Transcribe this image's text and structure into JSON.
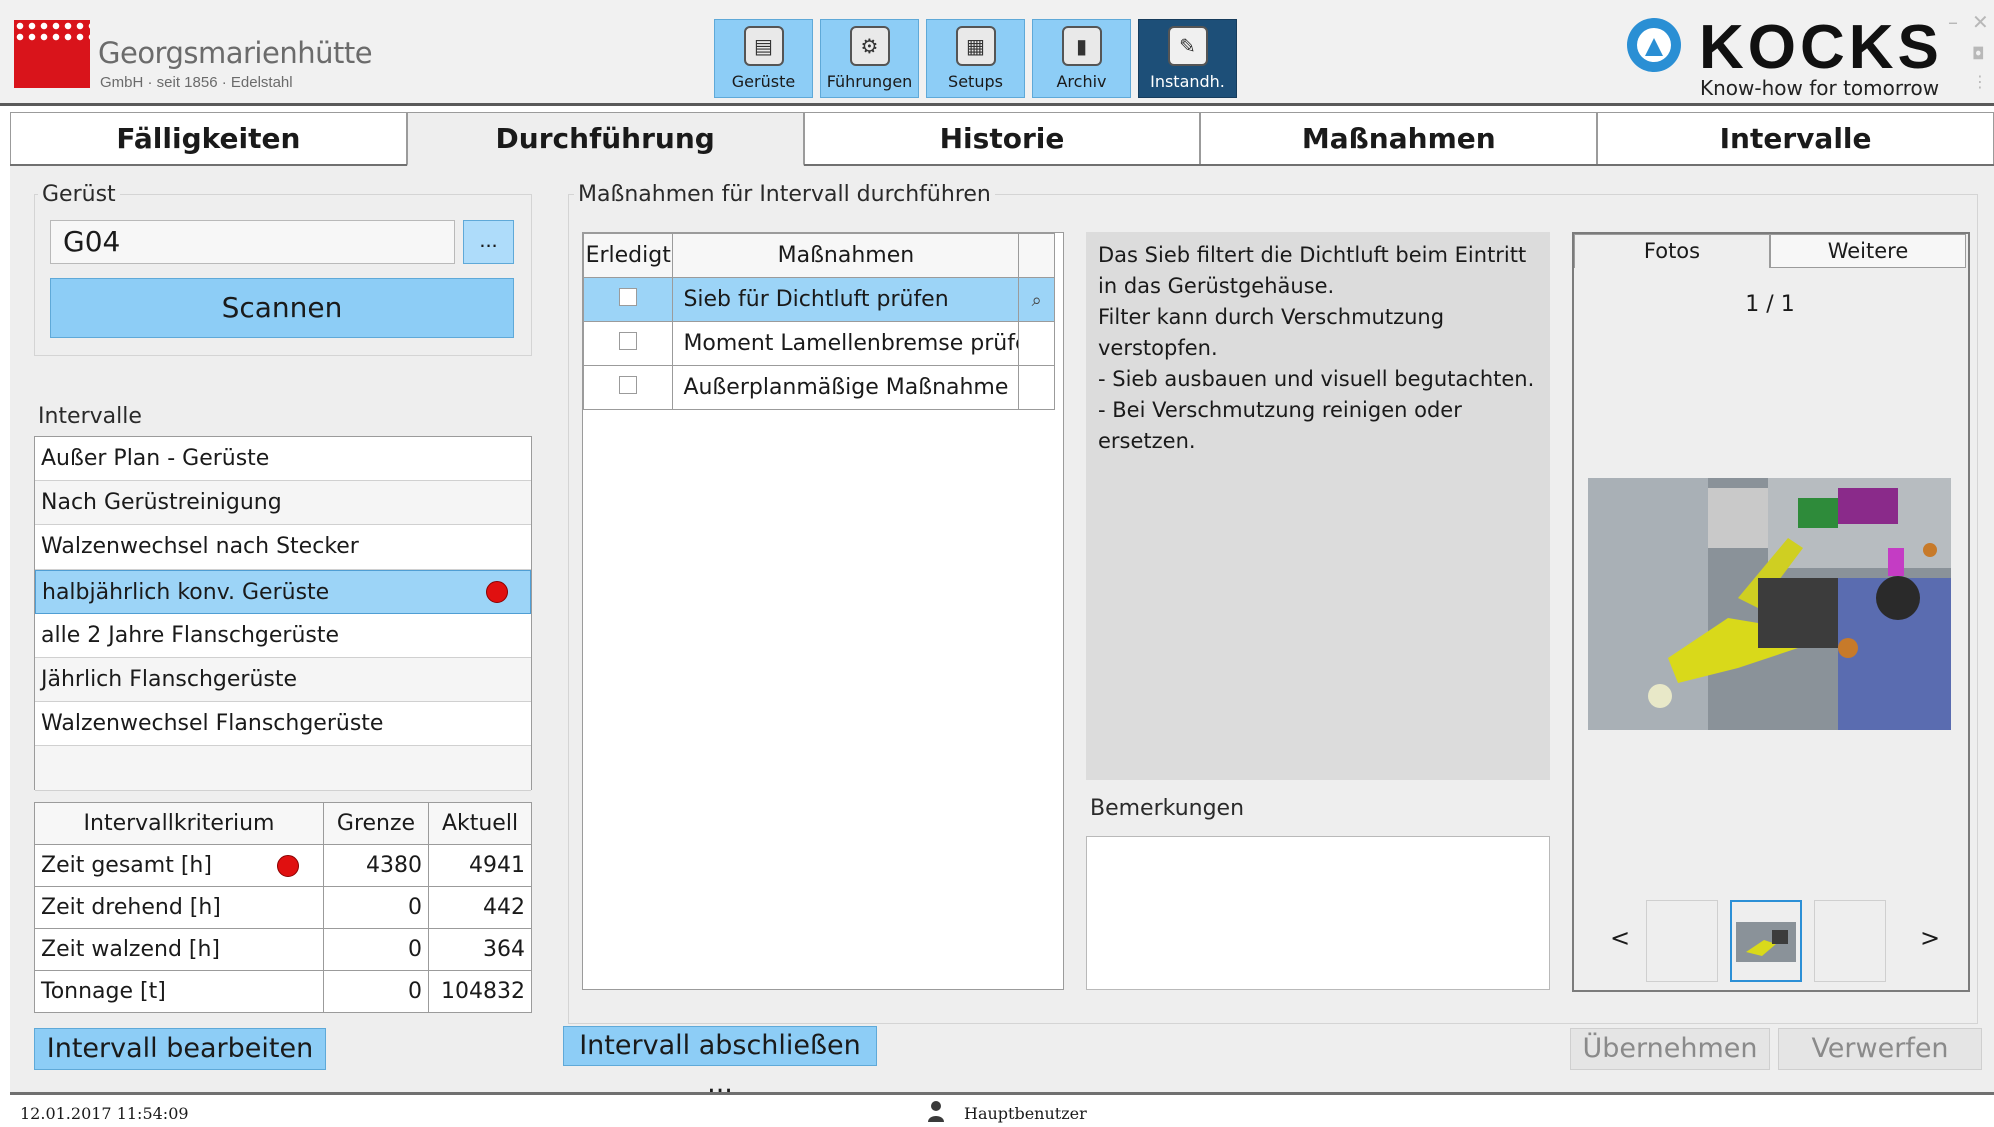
{
  "brand": {
    "company_name": "Georgsmarienhütte",
    "company_sub": "GmbH · seit 1856 · Edelstahl",
    "partner_name": "KOCKS",
    "partner_tagline": "Know-how for tomorrow"
  },
  "modules": [
    {
      "label": "Gerüste",
      "icon": "stand-icon",
      "active": false
    },
    {
      "label": "Führungen",
      "icon": "guide-icon",
      "active": false
    },
    {
      "label": "Setups",
      "icon": "setups-icon",
      "active": false
    },
    {
      "label": "Archiv",
      "icon": "archive-icon",
      "active": false
    },
    {
      "label": "Instandh.",
      "icon": "wrench-icon",
      "active": true
    }
  ],
  "tabs": [
    {
      "label": "Fälligkeiten",
      "active": false
    },
    {
      "label": "Durchführung",
      "active": true
    },
    {
      "label": "Historie",
      "active": false
    },
    {
      "label": "Maßnahmen",
      "active": false
    },
    {
      "label": "Intervalle",
      "active": false
    }
  ],
  "stand": {
    "group_label": "Gerüst",
    "value": "G04",
    "browse_label": "...",
    "scan_label": "Scannen"
  },
  "intervals": {
    "label": "Intervalle",
    "items": [
      {
        "label": "Außer Plan - Gerüste",
        "selected": false,
        "due": false
      },
      {
        "label": "Nach Gerüstreinigung",
        "selected": false,
        "due": false
      },
      {
        "label": "Walzenwechsel nach Stecker",
        "selected": false,
        "due": false
      },
      {
        "label": "halbjährlich konv. Gerüste",
        "selected": true,
        "due": true
      },
      {
        "label": "alle 2 Jahre Flanschgerüste",
        "selected": false,
        "due": false
      },
      {
        "label": "Jährlich Flanschgerüste",
        "selected": false,
        "due": false
      },
      {
        "label": "Walzenwechsel Flanschgerüste",
        "selected": false,
        "due": false
      },
      {
        "label": "",
        "selected": false,
        "due": false
      }
    ]
  },
  "criteria": {
    "headers": [
      "Intervallkriterium",
      "Grenze",
      "Aktuell"
    ],
    "rows": [
      {
        "name": "Zeit gesamt [h]",
        "limit": "4380",
        "current": "4941",
        "due": true
      },
      {
        "name": "Zeit drehend [h]",
        "limit": "0",
        "current": "442",
        "due": false
      },
      {
        "name": "Zeit walzend [h]",
        "limit": "0",
        "current": "364",
        "due": false
      },
      {
        "name": "Tonnage [t]",
        "limit": "0",
        "current": "104832",
        "due": false
      }
    ]
  },
  "actions": {
    "edit_interval": "Intervall bearbeiten",
    "close_interval": "Intervall abschließen ...",
    "apply": "Übernehmen",
    "discard": "Verwerfen"
  },
  "measures": {
    "group_label": "Maßnahmen für Intervall durchführen",
    "headers": [
      "Erledigt",
      "Maßnahmen"
    ],
    "rows": [
      {
        "label": "Sieb für Dichtluft prüfen",
        "done": false,
        "selected": true
      },
      {
        "label": "Moment Lamellenbremse prüfen",
        "done": false,
        "selected": false
      },
      {
        "label": "Außerplanmäßige Maßnahme",
        "done": false,
        "selected": false
      }
    ],
    "description": "Das Sieb filtert die Dichtluft beim Eintritt\nin das Gerüstgehäuse.\nFilter kann durch Verschmutzung\nverstopfen.\n- Sieb ausbauen und visuell begutachten.\n- Bei Verschmutzung reinigen oder\nersetzen.",
    "remarks_label": "Bemerkungen",
    "remarks_value": ""
  },
  "photos": {
    "tabs": [
      "Fotos",
      "Weitere"
    ],
    "counter": "1 / 1",
    "prev": "<",
    "next": ">"
  },
  "status": {
    "datetime": "12.01.2017 11:54:09",
    "user": "Hauptbenutzer"
  },
  "colors": {
    "accent": "#8dcdf6",
    "selected_row": "#9cd4f7",
    "active_module": "#1d4f78",
    "due_dot": "#e01010",
    "kocks_blue": "#2a8fd4",
    "gmh_red": "#d9141b"
  }
}
